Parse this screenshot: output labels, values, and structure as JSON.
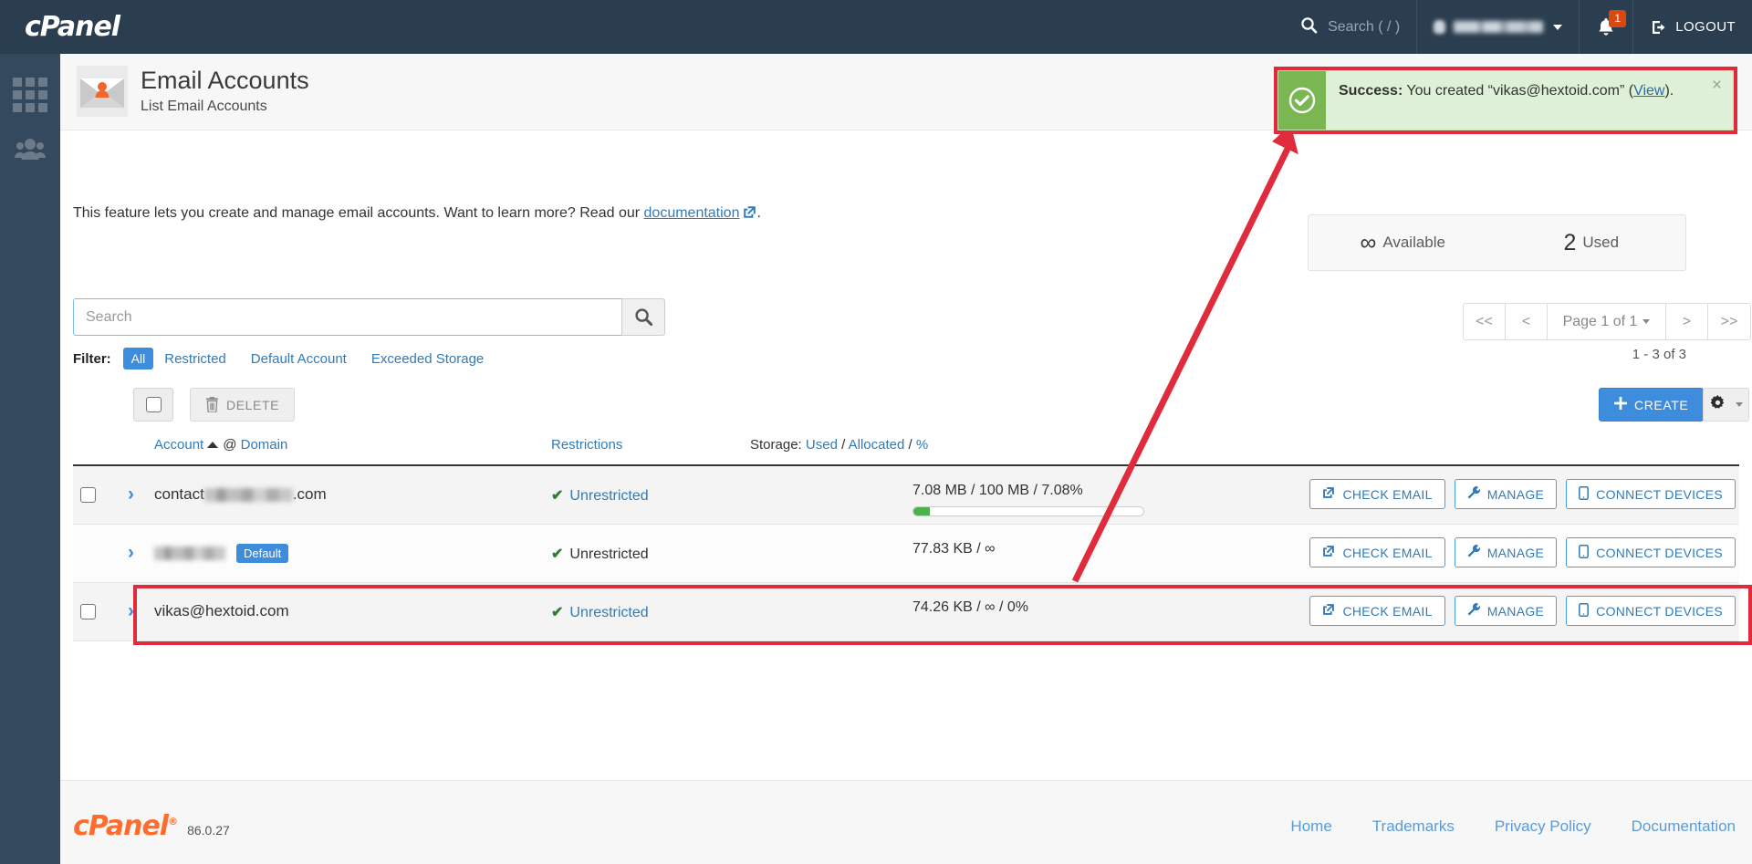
{
  "topbar": {
    "brand": "cPanel",
    "search_placeholder": "Search ( / )",
    "user_name_redacted": "",
    "notification_count": "1",
    "logout_label": "LOGOUT"
  },
  "sidebar": {
    "items": [
      {
        "name": "apps-grid",
        "label": ""
      },
      {
        "name": "user-manager",
        "label": ""
      }
    ]
  },
  "header": {
    "title": "Email Accounts",
    "subtitle": "List Email Accounts",
    "icon": "email-account-icon"
  },
  "description": {
    "text_before": "This feature lets you create and manage email accounts. Want to learn more? Read our ",
    "link": "documentation",
    "text_after": "."
  },
  "search": {
    "placeholder": "Search",
    "value": "",
    "button_icon": "search-icon"
  },
  "filter": {
    "label": "Filter:",
    "options": [
      {
        "label": "All",
        "active": true
      },
      {
        "label": "Restricted",
        "active": false
      },
      {
        "label": "Default Account",
        "active": false
      },
      {
        "label": "Exceeded Storage",
        "active": false
      }
    ]
  },
  "stats": {
    "available_value": "∞",
    "available_label": "Available",
    "used_value": "2",
    "used_label": "Used"
  },
  "pagination": {
    "first": "<<",
    "prev": "<",
    "page_label": "Page 1 of 1",
    "next": ">",
    "last": ">>",
    "range": "1 - 3 of 3"
  },
  "toolbar": {
    "select_all_label": "",
    "delete_label": "DELETE",
    "create_label": "CREATE",
    "settings_label": ""
  },
  "table": {
    "headers": {
      "account": "Account",
      "at": "@",
      "domain": "Domain",
      "restrictions": "Restrictions",
      "storage_prefix": "Storage:",
      "storage_used": "Used",
      "storage_sep1": "/",
      "storage_allocated": "Allocated",
      "storage_sep2": "/",
      "storage_percent": "%"
    },
    "rows": [
      {
        "has_checkbox": true,
        "account_visible": "contact",
        "account_redacted": true,
        "account_suffix": ".com",
        "is_default": false,
        "default_badge": "",
        "restriction": "Unrestricted",
        "restriction_is_link": true,
        "storage": "7.08 MB / 100 MB / 7.08%",
        "has_meter": true,
        "meter_percent": 7.08,
        "actions": [
          "CHECK EMAIL",
          "MANAGE",
          "CONNECT DEVICES"
        ],
        "highlighted": false
      },
      {
        "has_checkbox": false,
        "account_visible": "",
        "account_redacted": true,
        "account_suffix": "",
        "is_default": true,
        "default_badge": "Default",
        "restriction": "Unrestricted",
        "restriction_is_link": false,
        "storage": "77.83 KB / ∞",
        "has_meter": false,
        "meter_percent": 0,
        "actions": [
          "CHECK EMAIL",
          "MANAGE",
          "CONNECT DEVICES"
        ],
        "highlighted": false
      },
      {
        "has_checkbox": true,
        "account_visible": "vikas@hextoid.com",
        "account_redacted": false,
        "account_suffix": "",
        "is_default": false,
        "default_badge": "",
        "restriction": "Unrestricted",
        "restriction_is_link": true,
        "storage": "74.26 KB / ∞ / 0%",
        "has_meter": false,
        "meter_percent": 0,
        "actions": [
          "CHECK EMAIL",
          "MANAGE",
          "CONNECT DEVICES"
        ],
        "highlighted": true
      }
    ]
  },
  "toast": {
    "strong": "Success:",
    "text": " You created “vikas@hextoid.com” (",
    "link": "View",
    "tail": ").",
    "close": "×",
    "icon": "check-circle-icon"
  },
  "footer": {
    "logo": "cPanel",
    "version": "86.0.27",
    "links": [
      "Home",
      "Trademarks",
      "Privacy Policy",
      "Documentation"
    ]
  },
  "colors": {
    "brand_dark": "#2b3e50",
    "rail": "#34495e",
    "accent_blue": "#3e8ddd",
    "link_blue": "#337ab7",
    "success_green": "#7ab752",
    "success_bg": "#dff0d8",
    "annotation_red": "#e02b3d",
    "orange": "#ff6c2c",
    "meter_green": "#4caf50"
  }
}
